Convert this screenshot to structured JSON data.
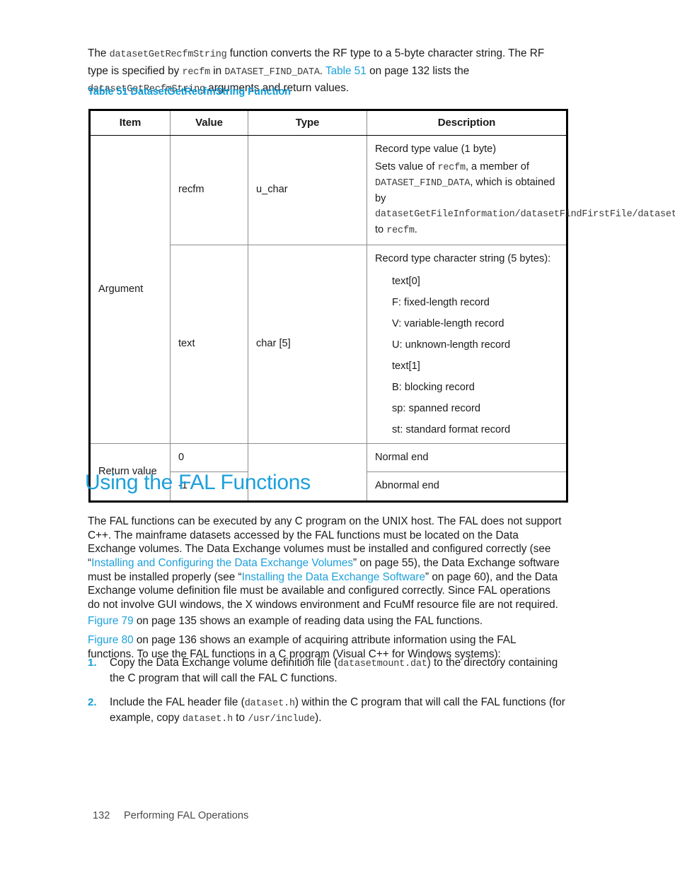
{
  "intro": {
    "seg1": "The ",
    "code1": "datasetGetRecfmString",
    "seg2": " function converts the RF type to a 5-byte character string. The RF type is specified by ",
    "code2": "recfm",
    "seg3": " in ",
    "code3": "DATASET_FIND_DATA",
    "seg4": ". ",
    "link1": "Table 51",
    "seg5": " on page 132 lists the ",
    "code4": "datasetGetRecfmString",
    "seg6": " arguments and return values."
  },
  "table": {
    "caption": "Table 51 DatasetGetRecfmString Function",
    "headers": [
      "Item",
      "Value",
      "Type",
      "Description"
    ],
    "rows": {
      "argument_label": "Argument",
      "recfm": {
        "value": "recfm",
        "type": "u_char",
        "desc_line1": "Record type value (1 byte)",
        "desc2_a": "Sets value of ",
        "desc2_code1": "recfm",
        "desc2_b": ", a member of ",
        "desc2_code2": "DATASET_FIND_DATA",
        "desc2_c": ", which is obtained by ",
        "desc2_code3": "datasetGetFileInformation",
        "desc2_slash1": "/",
        "desc2_code4": "datasetFindFirstFile",
        "desc2_slash2": "/",
        "desc2_code5": "datasetFindNextFile",
        "desc2_d": ", to ",
        "desc2_code6": "recfm",
        "desc2_e": "."
      },
      "text": {
        "value": "text",
        "type": "char [5]",
        "desc_line1": "Record type character string (5 bytes):",
        "items": [
          "text[0]",
          "F: fixed-length record",
          "V: variable-length record",
          "U: unknown-length record",
          "text[1]",
          "B: blocking record",
          "sp: spanned record",
          "st: standard format record"
        ]
      },
      "return_label": "Return value",
      "return_rows": [
        {
          "value": "0",
          "desc": "Normal end"
        },
        {
          "value": "-1",
          "desc": "Abnormal end"
        }
      ]
    }
  },
  "section": {
    "heading": "Using the FAL Functions"
  },
  "fal_paragraph": {
    "a": "The FAL functions can be executed by any C program on the UNIX host. The FAL does not support C++. The mainframe datasets accessed by the FAL functions must be located on the Data Exchange volumes. The Data Exchange volumes must be installed and configured correctly (see “",
    "link1": "Installing and Configuring the Data Exchange Volumes",
    "b": "” on page 55), the Data Exchange software must be installed properly (see “",
    "link2": "Installing the Data Exchange Software",
    "c": "” on page 60), and the Data Exchange volume definition file must be available and configured correctly. Since FAL operations do not involve GUI windows, the X windows environment and FcuMf resource file are not required."
  },
  "figure79": {
    "link": "Figure 79",
    "text": " on page 135 shows an example of reading data using the FAL functions."
  },
  "figure80": {
    "link": "Figure 80",
    "a": " on page 136 shows an example of acquiring attribute information using the FAL functions. To use the FAL functions in a C program (Visual C++ for Windows systems):"
  },
  "steps": [
    {
      "num": "1.",
      "a": "Copy the Data Exchange volume definition file (",
      "code1": "datasetmount.dat",
      "b": ") to the directory containing the C program that will call the FAL C functions."
    },
    {
      "num": "2.",
      "a": "Include the FAL header file (",
      "code1": "dataset.h",
      "b": ") within the C program that will call the FAL functions (for example, copy ",
      "code2": "dataset.h",
      "c": " to ",
      "code3": "/usr/include",
      "d": ")."
    }
  ],
  "footer": {
    "page_number": "132",
    "title": "Performing FAL Operations"
  },
  "colors": {
    "link": "#1CA0DB",
    "heading": "#1CA0DB",
    "caption": "#0F9CD8",
    "text": "#1a1a1a",
    "code": "#3a3a3a"
  }
}
